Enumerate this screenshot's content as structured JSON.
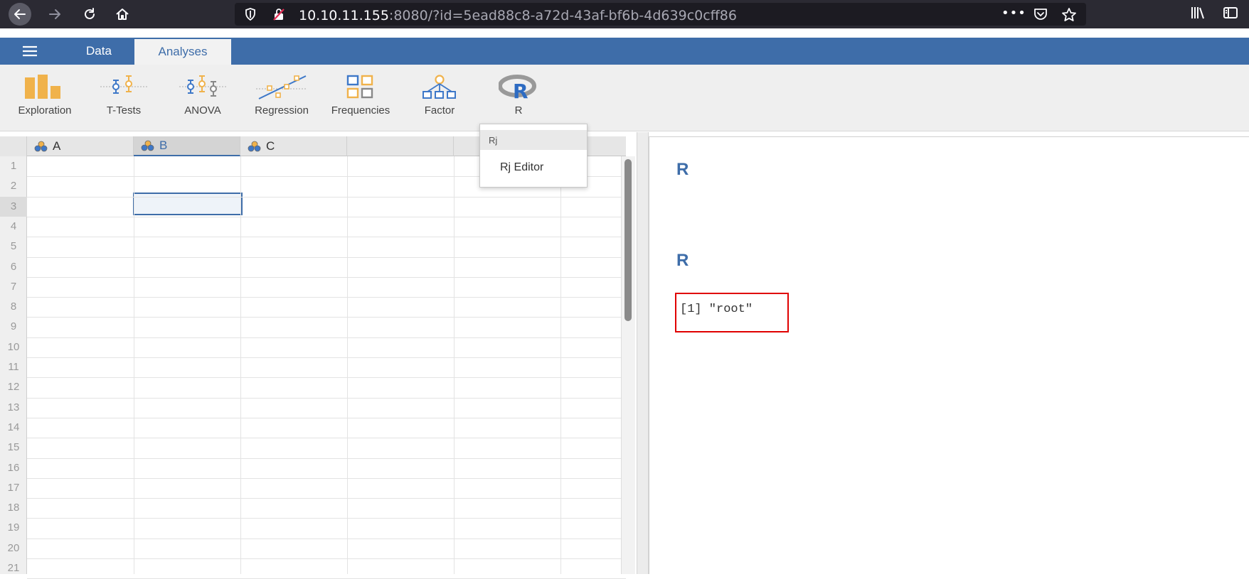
{
  "browser": {
    "url_host": "10.10.11.155",
    "url_rest": ":8080/?id=5ead88c8-a72d-43af-bf6b-4d639c0cff86",
    "more_label": "•••"
  },
  "header": {
    "tabs": [
      {
        "label": "Data"
      },
      {
        "label": "Analyses"
      }
    ]
  },
  "ribbon": {
    "items": [
      {
        "label": "Exploration",
        "icon": "exploration-icon"
      },
      {
        "label": "T-Tests",
        "icon": "ttests-icon"
      },
      {
        "label": "ANOVA",
        "icon": "anova-icon"
      },
      {
        "label": "Regression",
        "icon": "regression-icon"
      },
      {
        "label": "Frequencies",
        "icon": "frequencies-icon"
      },
      {
        "label": "Factor",
        "icon": "factor-icon"
      },
      {
        "label": "R",
        "icon": "r-logo-icon"
      }
    ]
  },
  "dropdown": {
    "group": "Rj",
    "items": [
      "Rj Editor"
    ]
  },
  "spreadsheet": {
    "columns": [
      "A",
      "B",
      "C"
    ],
    "selected_column": "B",
    "rows": [
      "1",
      "2",
      "3",
      "4",
      "5",
      "6",
      "7",
      "8",
      "9",
      "10",
      "11",
      "12",
      "13",
      "14",
      "15",
      "16",
      "17",
      "18",
      "19",
      "20",
      "21"
    ],
    "selected_row": "3"
  },
  "results": {
    "heading_1": "R",
    "heading_2": "R",
    "output": "[1] \"root\""
  },
  "colors": {
    "accent": "#3e6da9",
    "ribbon_icon": "#f0b24b",
    "ribbon_icon_blue": "#3e78c8",
    "highlight_box": "#e00000"
  }
}
